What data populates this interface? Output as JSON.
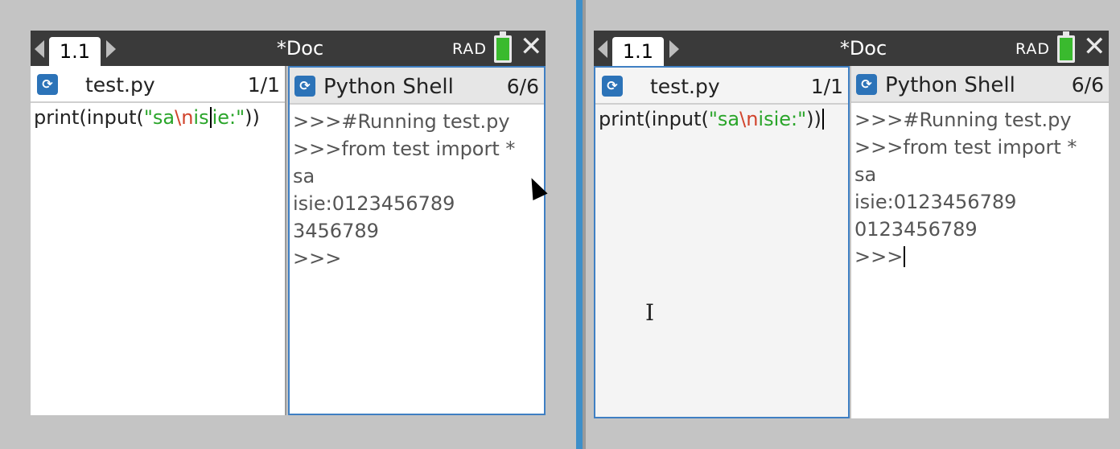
{
  "calculators": [
    {
      "tab_label": "1.1",
      "doc_title": "*Doc",
      "angle_mode": "RAD",
      "editor": {
        "file_name": "test.py",
        "page_count": "1/1",
        "code_prefix": "print(input(",
        "string_open": "\"sa",
        "escape": "\\n",
        "string_mid_before_caret": "is",
        "string_mid_after_caret": "ie:\"",
        "code_suffix": "))"
      },
      "shell": {
        "title": "Python Shell",
        "page_count": "6/6",
        "lines": [
          ">>>#Running test.py",
          ">>>from test import *",
          "sa",
          "isie:0123456789",
          "3456789",
          ">>>"
        ]
      }
    },
    {
      "tab_label": "1.1",
      "doc_title": "*Doc",
      "angle_mode": "RAD",
      "editor": {
        "file_name": "test.py",
        "page_count": "1/1",
        "code_prefix": "print(input(",
        "string_open": "\"sa",
        "escape": "\\n",
        "string_rest": "isie:\"",
        "code_suffix": "))"
      },
      "shell": {
        "title": "Python Shell",
        "page_count": "6/6",
        "lines": [
          ">>>#Running test.py",
          ">>>from test import *",
          "sa",
          "isie:0123456789",
          "0123456789",
          ">>>"
        ]
      }
    }
  ],
  "colors": {
    "accent": "#3f7fc3",
    "titlebar": "#3a3a3a",
    "string": "#2aa52a",
    "escape": "#d1442c",
    "battery": "#3aba2e"
  },
  "icons": [
    "python-icon",
    "battery-icon",
    "close-icon",
    "chevron-left-icon",
    "chevron-right-icon"
  ]
}
